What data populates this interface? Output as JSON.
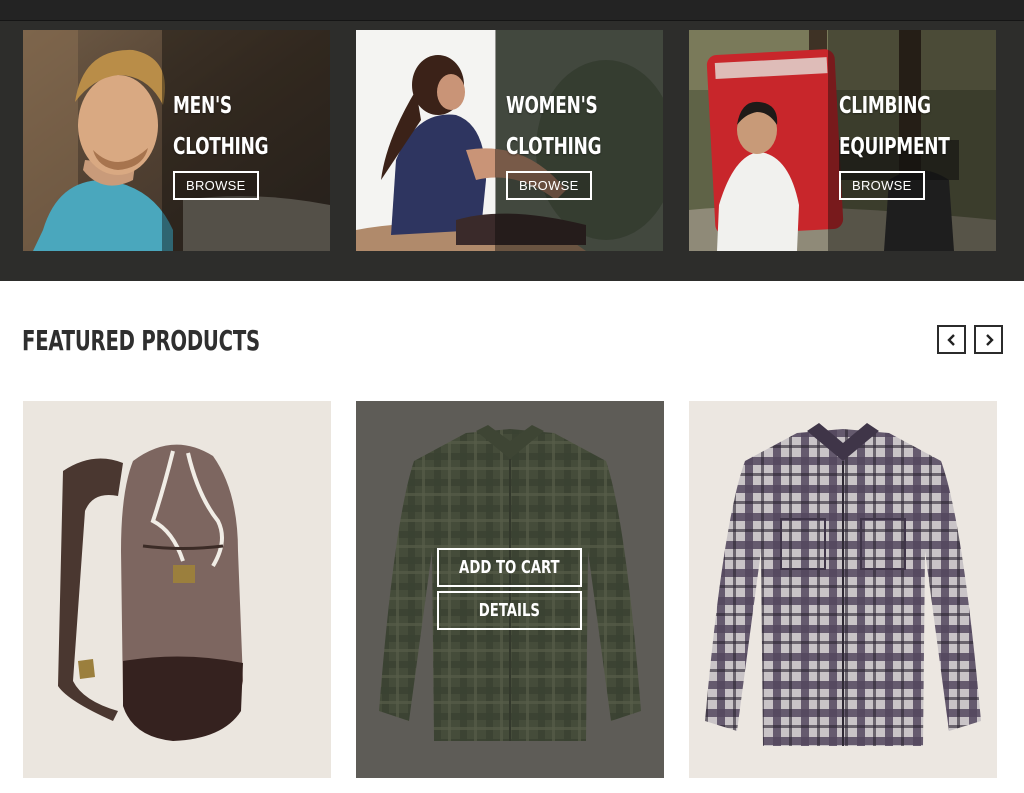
{
  "categories": [
    {
      "line1": "MEN'S",
      "line2": "CLOTHING",
      "button": "BROWSE"
    },
    {
      "line1": "WOMEN'S",
      "line2": "CLOTHING",
      "button": "BROWSE"
    },
    {
      "line1": "CLIMBING",
      "line2": "EQUIPMENT",
      "button": "BROWSE"
    }
  ],
  "featured": {
    "title": "FEATURED PRODUCTS",
    "hover_actions": {
      "add_to_cart": "ADD TO CART",
      "details": "DETAILS"
    }
  },
  "icons": {
    "prev": "chevron-left-icon",
    "next": "chevron-right-icon"
  },
  "colors": {
    "band_background": "#2d2d2b",
    "title_text": "#2f2f2f",
    "product_background": "#ece7e1"
  }
}
